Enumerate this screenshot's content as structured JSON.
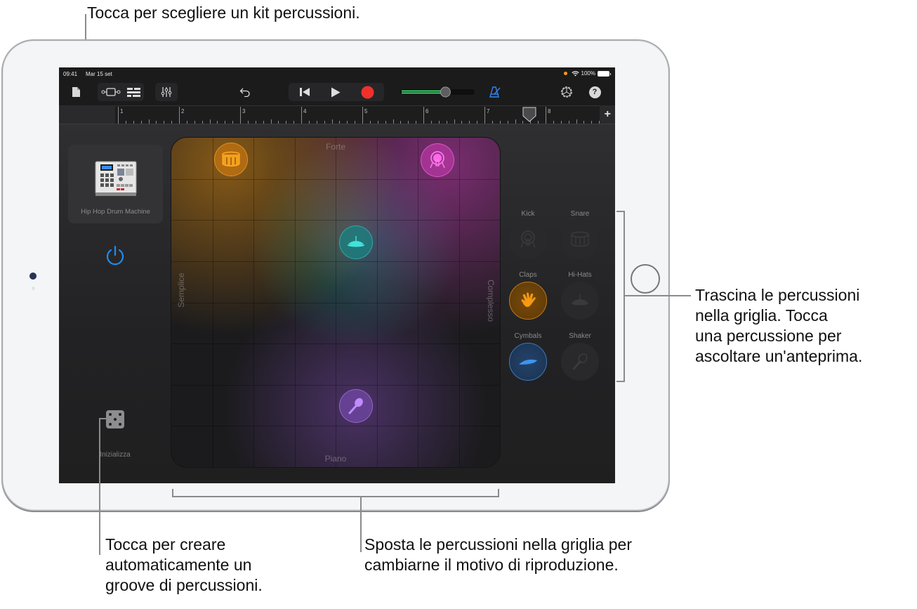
{
  "callouts": {
    "top": "Tocca per scegliere un kit percussioni.",
    "right": [
      "Trascina le percussioni",
      "nella griglia. Tocca",
      "una percussione per",
      "ascoltare un'anteprima."
    ],
    "bottom_left": [
      "Tocca per creare",
      "automaticamente un",
      "groove di percussioni."
    ],
    "bottom_center": [
      "Sposta le percussioni nella griglia per",
      "cambiarne il motivo di riproduzione."
    ]
  },
  "statusbar": {
    "time": "09:41",
    "date": "Mar 15 set",
    "battery": "100%"
  },
  "toolbar": {
    "icons": [
      "document-icon",
      "tracks-view-icon",
      "list-view-icon",
      "mixer-icon",
      "undo-icon",
      "rewind-icon",
      "play-icon",
      "record-icon",
      "volume-slider",
      "metronome-icon",
      "settings-icon",
      "help-icon"
    ],
    "volume_level": 0.6,
    "help_label": "?"
  },
  "ruler": {
    "bars": [
      "1",
      "2",
      "3",
      "4",
      "5",
      "6",
      "7",
      "8"
    ],
    "add_label": "+"
  },
  "kit": {
    "name": "Hip Hop Drum Machine"
  },
  "autoplay": {
    "label": "Inizializza"
  },
  "pad": {
    "top": "Forte",
    "bottom": "Piano",
    "left": "Semplice",
    "right": "Complesso",
    "pucks": [
      {
        "name": "Snare",
        "color": "#f29a14"
      },
      {
        "name": "Kick",
        "color": "#e455d6"
      },
      {
        "name": "Hi-Hats",
        "color": "#2ed6d0"
      },
      {
        "name": "Shaker",
        "color": "#b07df2"
      }
    ]
  },
  "instruments": [
    {
      "label": "Kick",
      "active": false
    },
    {
      "label": "Snare",
      "active": false
    },
    {
      "label": "Claps",
      "active": true,
      "color": "#f59a12"
    },
    {
      "label": "Hi-Hats",
      "active": false
    },
    {
      "label": "Cymbals",
      "active": true,
      "color": "#3d94f0"
    },
    {
      "label": "Shaker",
      "active": false
    }
  ]
}
